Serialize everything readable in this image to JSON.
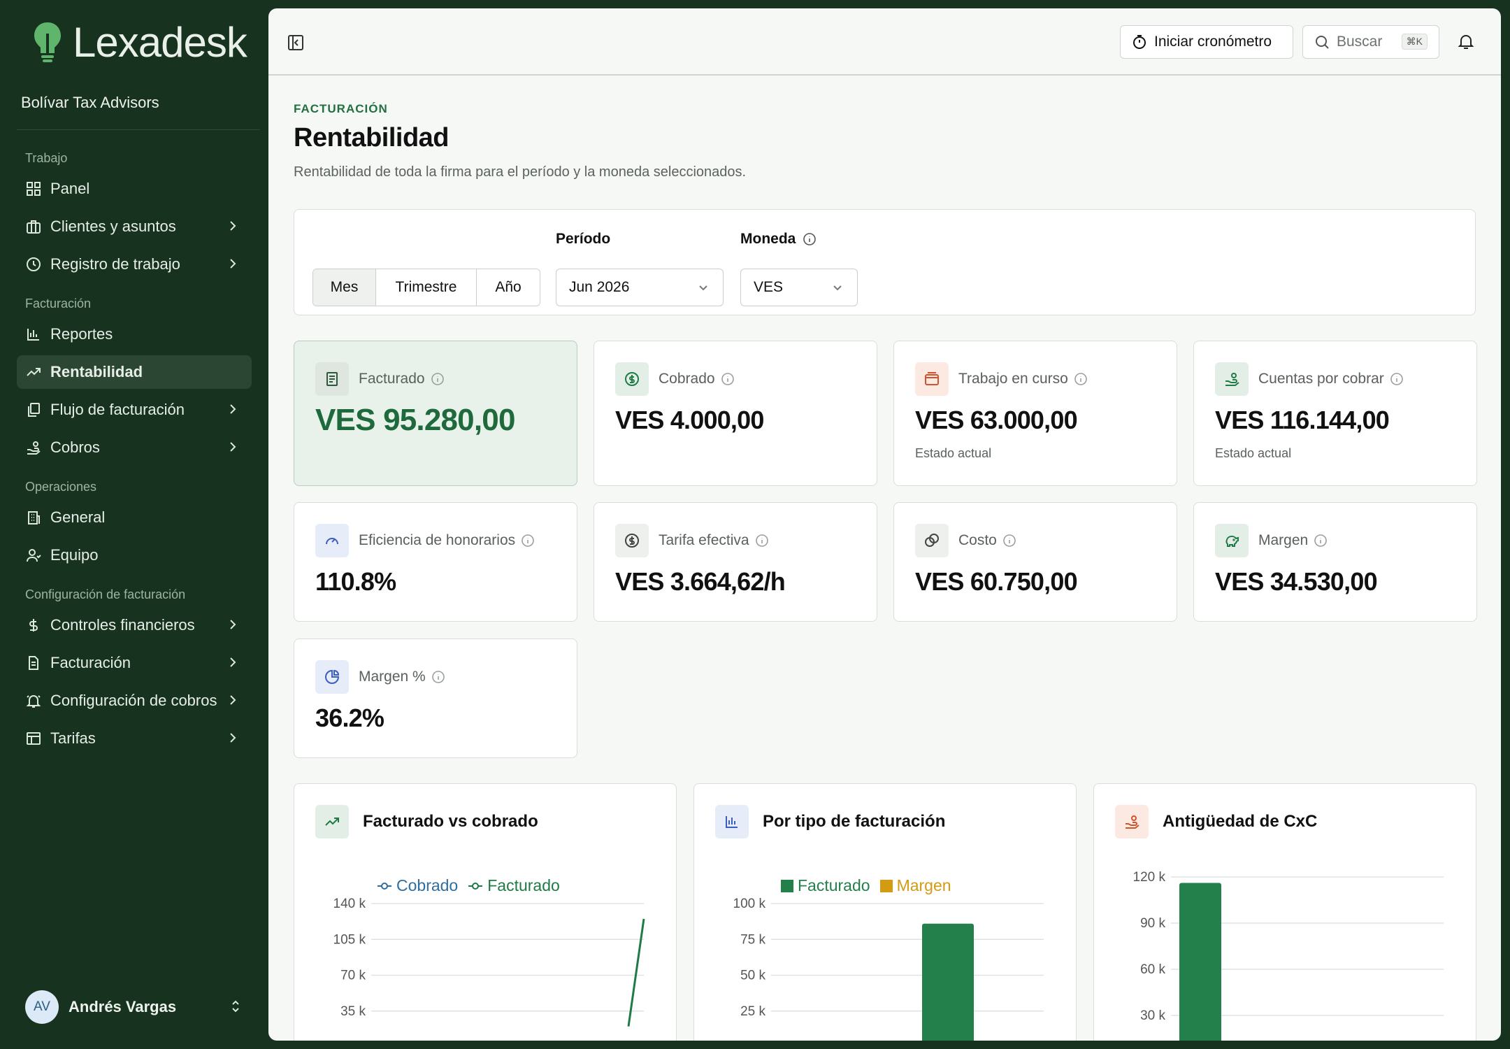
{
  "app": {
    "name": "Lexadesk",
    "firm": "Bolívar Tax Advisors"
  },
  "sidebar": {
    "sections": [
      {
        "title": "Trabajo",
        "items": [
          {
            "label": "Panel",
            "icon": "grid-icon",
            "chevron": false
          },
          {
            "label": "Clientes y asuntos",
            "icon": "briefcase-icon",
            "chevron": true
          },
          {
            "label": "Registro de trabajo",
            "icon": "clock-icon",
            "chevron": true
          }
        ]
      },
      {
        "title": "Facturación",
        "items": [
          {
            "label": "Reportes",
            "icon": "bar-chart-icon",
            "chevron": false
          },
          {
            "label": "Rentabilidad",
            "icon": "trend-icon",
            "chevron": false,
            "active": true
          },
          {
            "label": "Flujo de facturación",
            "icon": "documents-icon",
            "chevron": true
          },
          {
            "label": "Cobros",
            "icon": "hand-coins-icon",
            "chevron": true
          }
        ]
      },
      {
        "title": "Operaciones",
        "items": [
          {
            "label": "General",
            "icon": "building-icon",
            "chevron": false
          },
          {
            "label": "Equipo",
            "icon": "users-icon",
            "chevron": false
          }
        ]
      },
      {
        "title": "Configuración de facturación",
        "items": [
          {
            "label": "Controles financieros",
            "icon": "dollar-icon",
            "chevron": true
          },
          {
            "label": "Facturación",
            "icon": "file-icon",
            "chevron": true
          },
          {
            "label": "Configuración de cobros",
            "icon": "bell-ring-icon",
            "chevron": true
          },
          {
            "label": "Tarifas",
            "icon": "table-icon",
            "chevron": true
          }
        ]
      }
    ],
    "user": {
      "initials": "AV",
      "name": "Andrés Vargas"
    }
  },
  "topbar": {
    "timer_label": "Iniciar cronómetro",
    "search_placeholder": "Buscar",
    "search_shortcut": "⌘K"
  },
  "page": {
    "eyebrow": "FACTURACIÓN",
    "title": "Rentabilidad",
    "subtitle": "Rentabilidad de toda la firma para el período y la moneda seleccionados."
  },
  "filters": {
    "granularity": [
      "Mes",
      "Trimestre",
      "Año"
    ],
    "granularity_selected": "Mes",
    "period_label": "Período",
    "period_value": "Jun 2026",
    "currency_label": "Moneda",
    "currency_value": "VES"
  },
  "kpis": [
    {
      "label": "Facturado",
      "value": "VES 95.280,00",
      "note": "",
      "icon": "receipt-icon",
      "icon_bg": "#dfe6e0",
      "icon_color": "#2d5a3a"
    },
    {
      "label": "Cobrado",
      "value": "VES 4.000,00",
      "note": "",
      "icon": "dollar-circle-icon",
      "icon_bg": "#e3efe6",
      "icon_color": "#1f7a45"
    },
    {
      "label": "Trabajo en curso",
      "value": "VES 63.000,00",
      "note": "Estado actual",
      "icon": "wallet-icon",
      "icon_bg": "#fbe9e2",
      "icon_color": "#d0532a"
    },
    {
      "label": "Cuentas por cobrar",
      "value": "VES 116.144,00",
      "note": "Estado actual",
      "icon": "hand-coins-icon",
      "icon_bg": "#e3efe6",
      "icon_color": "#1f7a45"
    },
    {
      "label": "Eficiencia de honorarios",
      "value": "110.8%",
      "note": "",
      "icon": "gauge-icon",
      "icon_bg": "#e6ecf8",
      "icon_color": "#3a5fc0"
    },
    {
      "label": "Tarifa efectiva",
      "value": "VES 3.664,62/h",
      "note": "",
      "icon": "badge-dollar-icon",
      "icon_bg": "#eef0ee",
      "icon_color": "#444"
    },
    {
      "label": "Costo",
      "value": "VES 60.750,00",
      "note": "",
      "icon": "coins-icon",
      "icon_bg": "#eef0ee",
      "icon_color": "#444"
    },
    {
      "label": "Margen",
      "value": "VES 34.530,00",
      "note": "",
      "icon": "piggy-bank-icon",
      "icon_bg": "#e3efe6",
      "icon_color": "#1f7a45"
    },
    {
      "label": "Margen %",
      "value": "36.2%",
      "note": "",
      "icon": "pie-icon",
      "icon_bg": "#e6ecf8",
      "icon_color": "#3a5fc0"
    }
  ],
  "charts": {
    "titles": [
      "Facturado vs cobrado",
      "Por tipo de facturación",
      "Antigüedad de CxC"
    ]
  },
  "chart_data": [
    {
      "type": "line",
      "title": "Facturado vs cobrado",
      "series": [
        {
          "name": "Cobrado",
          "color": "#2f6e9e"
        },
        {
          "name": "Facturado",
          "color": "#1f7a45"
        }
      ],
      "ytick_labels": [
        "140 k",
        "105 k",
        "70 k",
        "35 k"
      ],
      "ylim": [
        0,
        140000
      ],
      "visible_points": {
        "Facturado": [
          20000,
          125000
        ]
      }
    },
    {
      "type": "bar",
      "title": "Por tipo de facturación",
      "series": [
        {
          "name": "Facturado",
          "color": "#23804a"
        },
        {
          "name": "Margen",
          "color": "#d39b12"
        }
      ],
      "ytick_labels": [
        "100 k",
        "75 k",
        "50 k",
        "25 k"
      ],
      "ylim": [
        0,
        100000
      ],
      "values": {
        "Facturado": 86000
      }
    },
    {
      "type": "bar",
      "title": "Antigüedad de CxC",
      "ytick_labels": [
        "120 k",
        "90 k",
        "60 k",
        "30 k"
      ],
      "ylim": [
        0,
        120000
      ],
      "values": [
        116144
      ],
      "color": "#23804a"
    }
  ]
}
